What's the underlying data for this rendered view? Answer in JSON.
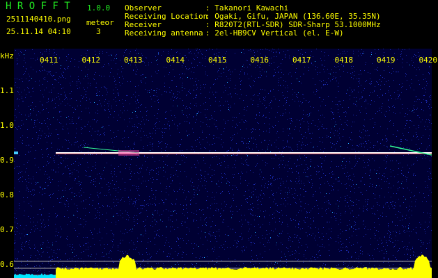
{
  "header": {
    "app_name": "H R O F F T",
    "version": "1.0.0",
    "filename": "2511140410.png",
    "datetime": "25.11.14 04:10",
    "meteor_label": "meteor",
    "meteor_count": "3",
    "info": [
      {
        "label": "Observer",
        "value": ": Takanori Kawachi"
      },
      {
        "label": "Receiving Location",
        "value": ": Ogaki, Gifu, JAPAN (136.60E, 35.35N)"
      },
      {
        "label": "Receiver",
        "value": ": R820T2(RTL-SDR) SDR-Sharp 53.1000MHz"
      },
      {
        "label": "Receiving antenna",
        "value": ": 2el-HB9CV Vertical (el. E-W)"
      }
    ]
  },
  "chart_data": {
    "type": "heatmap",
    "ylabel": "kHz",
    "yticks": [
      "1.1",
      "1.0",
      "0.9",
      "0.8",
      "0.7",
      "0.6"
    ],
    "ylim": [
      0.56,
      1.2
    ],
    "xticks": [
      "0411",
      "0412",
      "0413",
      "0414",
      "0415",
      "0416",
      "0417",
      "0418",
      "0419",
      "0420"
    ],
    "carrier_khz": 0.92,
    "colors": {
      "background": "#000033",
      "noise": "#2233cc",
      "carrier": "#ffffff",
      "histogram": "#ffff00",
      "histogram_start": "#00e5ff",
      "text": "#ffff00",
      "title": "#22ee22"
    }
  }
}
